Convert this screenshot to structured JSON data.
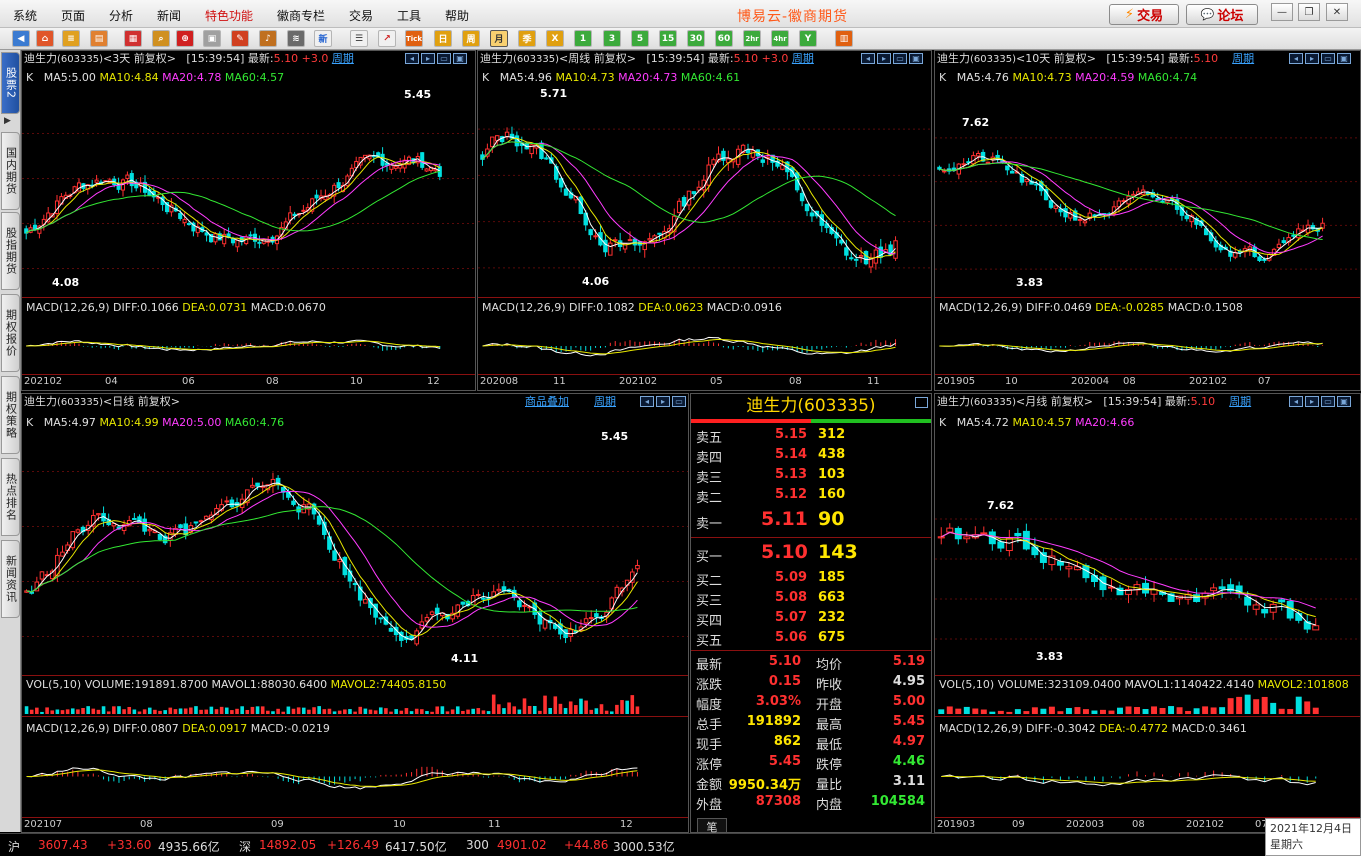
{
  "app": {
    "title": "博易云-徽商期货",
    "trade_btn": "交易",
    "forum_btn": "论坛"
  },
  "menu": [
    "系统",
    "页面",
    "分析",
    "新闻",
    "特色功能",
    "徽商专栏",
    "交易",
    "工具",
    "帮助"
  ],
  "toolbar": {
    "periods": [
      "月",
      "季",
      "X",
      "1",
      "3",
      "5",
      "15",
      "30",
      "60",
      "2hr",
      "4hr",
      "Y"
    ],
    "news_label": "新",
    "tick_label": "Tick",
    "day_label": "日",
    "week_label": "周"
  },
  "sidebar": [
    "股票2",
    "国内期货",
    "股指期货",
    "期权报价",
    "期权策略",
    "热点排名",
    "新闻资讯"
  ],
  "panels": {
    "p1": {
      "stock": "迪生力",
      "code": "(603335)",
      "period": "<3天",
      "adj": "前复权>",
      "time": "[15:39:54]",
      "latest_label": "最新:",
      "latest": "5.10",
      "change": "+3.0",
      "zq": "周期",
      "ma": {
        "k": "K",
        "ma5": "MA5:5.00",
        "ma10": "MA10:4.84",
        "ma20": "MA20:4.78",
        "ma60": "MA60:4.57"
      },
      "high": "5.45",
      "low": "4.08",
      "macd": {
        "name": "MACD(12,26,9)",
        "diff": "DIFF:0.1066",
        "dea": "DEA:0.0731",
        "macd": "MACD:0.0670"
      },
      "x": [
        "202102",
        "04",
        "06",
        "08",
        "10",
        "12"
      ]
    },
    "p2": {
      "stock": "迪生力",
      "code": "(603335)",
      "period": "<周线",
      "adj": "前复权>",
      "time": "[15:39:54]",
      "latest_label": "最新:",
      "latest": "5.10",
      "change": "+3.0",
      "zq": "周期",
      "ma": {
        "k": "K",
        "ma5": "MA5:4.96",
        "ma10": "MA10:4.73",
        "ma20": "MA20:4.73",
        "ma60": "MA60:4.61"
      },
      "high": "5.71",
      "low": "4.06",
      "macd": {
        "name": "MACD(12,26,9)",
        "diff": "DIFF:0.1082",
        "dea": "DEA:0.0623",
        "macd": "MACD:0.0916"
      },
      "x": [
        "202008",
        "11",
        "202102",
        "05",
        "08",
        "11"
      ]
    },
    "p3": {
      "stock": "迪生力",
      "code": "(603335)",
      "period": "<10天",
      "adj": "前复权>",
      "time": "[15:39:54]",
      "latest_label": "最新:",
      "latest": "5.10",
      "zq": "周期",
      "ma": {
        "k": "K",
        "ma5": "MA5:4.76",
        "ma10": "MA10:4.73",
        "ma20": "MA20:4.59",
        "ma60": "MA60:4.74"
      },
      "high": "7.62",
      "low": "3.83",
      "macd": {
        "name": "MACD(12,26,9)",
        "diff": "DIFF:0.0469",
        "dea": "DEA:-0.0285",
        "macd": "MACD:0.1508"
      },
      "x": [
        "201905",
        "10",
        "202004",
        "08",
        "202102",
        "07"
      ]
    },
    "p4": {
      "stock": "迪生力",
      "code": "(603335)",
      "period": "<日线",
      "adj": "前复权>",
      "overlay": "商品叠加",
      "zq": "周期",
      "ma": {
        "k": "K",
        "ma5": "MA5:4.97",
        "ma10": "MA10:4.99",
        "ma20": "MA20:5.00",
        "ma60": "MA60:4.76"
      },
      "high": "5.45",
      "low": "4.11",
      "vol": {
        "name": "VOL(5,10)",
        "volume": "VOLUME:191891.8700",
        "mavol1": "MAVOL1:88030.6400",
        "mavol2": "MAVOL2:74405.8150"
      },
      "macd": {
        "name": "MACD(12,26,9)",
        "diff": "DIFF:0.0807",
        "dea": "DEA:0.0917",
        "macd": "MACD:-0.0219"
      },
      "x": [
        "202107",
        "08",
        "09",
        "10",
        "11",
        "12"
      ]
    },
    "p5": {
      "stock": "迪生力",
      "code": "(603335)",
      "period": "<月线",
      "adj": "前复权>",
      "time": "[15:39:54]",
      "latest_label": "最新:",
      "latest": "5.10",
      "zq": "周期",
      "ma": {
        "k": "K",
        "ma5": "MA5:4.72",
        "ma10": "MA10:4.57",
        "ma20": "MA20:4.66"
      },
      "high": "7.62",
      "low": "3.83",
      "vol": {
        "name": "VOL(5,10)",
        "volume": "VOLUME:323109.0400",
        "mavol1": "MAVOL1:1140422.4140",
        "mavol2": "MAVOL2:101808"
      },
      "macd": {
        "name": "MACD(12,26,9)",
        "diff": "DIFF:-0.3042",
        "dea": "DEA:-0.4772",
        "macd": "MACD:0.3461"
      },
      "x": [
        "201903",
        "09",
        "202003",
        "08",
        "202102",
        "07"
      ]
    }
  },
  "quote": {
    "title": "迪生力(603335)",
    "asks": [
      {
        "l": "卖五",
        "p": "5.15",
        "v": "312"
      },
      {
        "l": "卖四",
        "p": "5.14",
        "v": "438"
      },
      {
        "l": "卖三",
        "p": "5.13",
        "v": "103"
      },
      {
        "l": "卖二",
        "p": "5.12",
        "v": "160"
      },
      {
        "l": "卖一",
        "p": "5.11",
        "v": "90"
      }
    ],
    "bids": [
      {
        "l": "买一",
        "p": "5.10",
        "v": "143"
      },
      {
        "l": "买二",
        "p": "5.09",
        "v": "185"
      },
      {
        "l": "买三",
        "p": "5.08",
        "v": "663"
      },
      {
        "l": "买四",
        "p": "5.07",
        "v": "232"
      },
      {
        "l": "买五",
        "p": "5.06",
        "v": "675"
      }
    ],
    "stats": [
      {
        "l1": "最新",
        "v1": "5.10",
        "l2": "均价",
        "v2": "5.19"
      },
      {
        "l1": "涨跌",
        "v1": "0.15",
        "l2": "昨收",
        "v2": "4.95"
      },
      {
        "l1": "幅度",
        "v1": "3.03%",
        "l2": "开盘",
        "v2": "5.00"
      },
      {
        "l1": "总手",
        "v1": "191892",
        "l2": "最高",
        "v2": "5.45"
      },
      {
        "l1": "现手",
        "v1": "862",
        "l2": "最低",
        "v2": "4.97"
      },
      {
        "l1": "涨停",
        "v1": "5.45",
        "l2": "跌停",
        "v2": "4.46"
      },
      {
        "l1": "金额",
        "v1": "9950.34万",
        "l2": "量比",
        "v2": "3.11"
      },
      {
        "l1": "外盘",
        "v1": "87308",
        "l2": "内盘",
        "v2": "104584"
      }
    ],
    "bottom_tab": "笔"
  },
  "status": {
    "sh_label": "沪",
    "sh_index": "3607.43",
    "sh_chg": "+33.60",
    "sh_amt": "4935.66亿",
    "sz_label": "深",
    "sz_index": "14892.05",
    "sz_chg": "+126.49",
    "sz_amt": "6417.50亿",
    "i300_label": "300",
    "i300_index": "4901.02",
    "i300_chg": "+44.86",
    "i300_amt": "3000.53亿",
    "date": "2021年12月4日",
    "weekday": "星期六"
  },
  "colors": {
    "up": "#ff3030",
    "down": "#00e0e0",
    "ma5": "#ffffff",
    "ma10": "#e8e800",
    "ma20": "#ff3cff",
    "ma60": "#33e833",
    "accent": "#ff5a1a"
  }
}
